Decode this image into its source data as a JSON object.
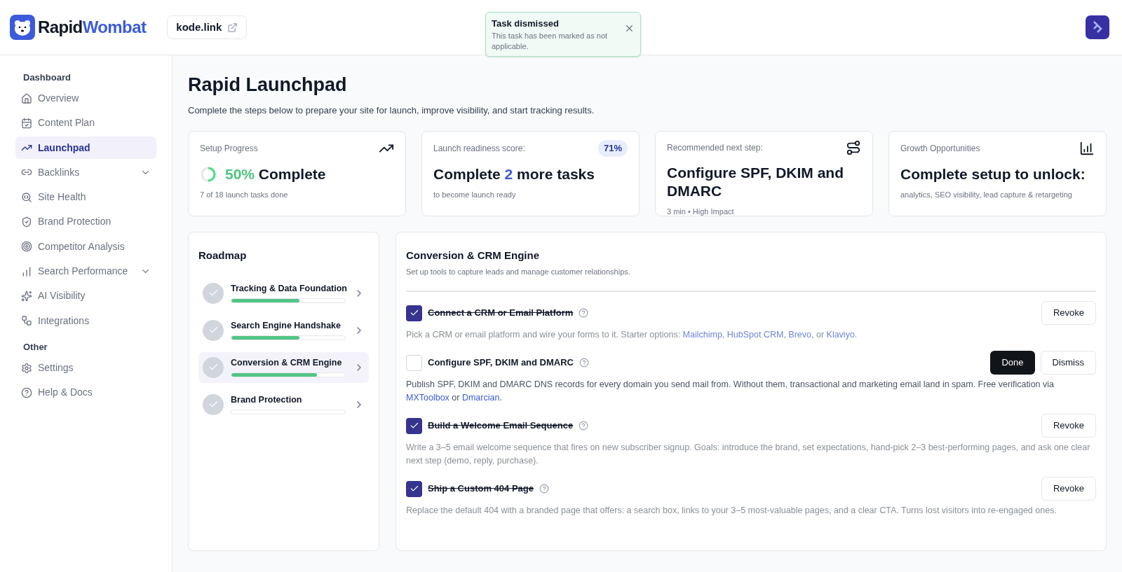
{
  "brand": {
    "first": "Rapid",
    "second": "Wombat"
  },
  "site_link": "kode.link",
  "toast": {
    "title": "Task dismissed",
    "message": "This task has been marked as not applicable."
  },
  "sidebar": {
    "sections": [
      {
        "heading": "Dashboard",
        "items": [
          {
            "label": "Overview",
            "selected": false,
            "has_submenu": false
          },
          {
            "label": "Content Plan",
            "selected": false,
            "has_submenu": false
          },
          {
            "label": "Launchpad",
            "selected": true,
            "has_submenu": false
          },
          {
            "label": "Backlinks",
            "selected": false,
            "has_submenu": true
          },
          {
            "label": "Site Health",
            "selected": false,
            "has_submenu": false
          },
          {
            "label": "Brand Protection",
            "selected": false,
            "has_submenu": false
          },
          {
            "label": "Competitor Analysis",
            "selected": false,
            "has_submenu": false
          },
          {
            "label": "Search Performance",
            "selected": false,
            "has_submenu": true
          },
          {
            "label": "AI Visibility",
            "selected": false,
            "has_submenu": false
          },
          {
            "label": "Integrations",
            "selected": false,
            "has_submenu": false
          }
        ]
      },
      {
        "heading": "Other",
        "items": [
          {
            "label": "Settings",
            "selected": false,
            "has_submenu": false
          },
          {
            "label": "Help & Docs",
            "selected": false,
            "has_submenu": false
          }
        ]
      }
    ]
  },
  "page": {
    "title": "Rapid Launchpad",
    "subtitle": "Complete the steps below to prepare your site for launch, improve visibility, and start tracking results."
  },
  "cards": [
    {
      "kind": "progress",
      "label": "Setup Progress",
      "level": 0.5,
      "headline": [
        {
          "text": "50%",
          "accent": true
        },
        {
          "text": " Complete",
          "accent": false
        }
      ],
      "note": "7 of 18 launch tasks done"
    },
    {
      "kind": "score",
      "label": "Launch readiness score:",
      "badge": "71%",
      "headline": [
        {
          "text": "Complete ",
          "accent": false
        },
        {
          "text": "2",
          "accent": true
        },
        {
          "text": " more tasks",
          "accent": false
        }
      ],
      "note": "to become launch ready"
    },
    {
      "kind": "next",
      "label": "Recommended next step:",
      "headline": [
        {
          "text": "Configure SPF, DKIM and DMARC",
          "accent": false
        }
      ],
      "note": "3 min • High Impact"
    },
    {
      "kind": "growth",
      "label": "Growth Opportunities",
      "headline": [
        {
          "text": "Complete setup to unlock:",
          "accent": false
        }
      ],
      "note": "analytics, SEO visibility, lead capture & retargeting"
    }
  ],
  "roadmap": {
    "title": "Roadmap",
    "items": [
      {
        "label": "Tracking & Data Foundation",
        "level": 0.6,
        "selected": false
      },
      {
        "label": "Search Engine Handshake",
        "level": 0.6,
        "selected": false
      },
      {
        "label": "Conversion & CRM Engine",
        "level": 0.75,
        "selected": true
      },
      {
        "label": "Brand Protection",
        "level": 0,
        "selected": false
      }
    ]
  },
  "section": {
    "title": "Conversion & CRM Engine",
    "subtitle": "Set up tools to capture leads and manage customer relationships.",
    "tasks": [
      {
        "title": "Connect a CRM or Email Platform",
        "checked": true,
        "description": [
          {
            "kind": "text",
            "text": "Pick a CRM or email platform and wire your forms to it. Starter options: "
          },
          {
            "kind": "link",
            "text": "Mailchimp"
          },
          {
            "kind": "text",
            "text": ", "
          },
          {
            "kind": "link",
            "text": "HubSpot CRM"
          },
          {
            "kind": "text",
            "text": ", "
          },
          {
            "kind": "link",
            "text": "Brevo"
          },
          {
            "kind": "text",
            "text": ", or "
          },
          {
            "kind": "link",
            "text": "Klaviyo"
          },
          {
            "kind": "text",
            "text": "."
          }
        ],
        "actions": [
          {
            "kind": "secondary",
            "label": "Revoke"
          }
        ]
      },
      {
        "title": "Configure SPF, DKIM and DMARC",
        "checked": false,
        "description": [
          {
            "kind": "text",
            "text": "Publish SPF, DKIM and DMARC DNS records for every domain you send mail from. Without them, transactional and marketing email land in spam. Free verification via "
          },
          {
            "kind": "link",
            "text": "MXToolbox"
          },
          {
            "kind": "text",
            "text": " or "
          },
          {
            "kind": "link",
            "text": "Dmarcian"
          },
          {
            "kind": "text",
            "text": "."
          }
        ],
        "actions": [
          {
            "kind": "primary",
            "label": "Done"
          },
          {
            "kind": "secondary",
            "label": "Dismiss"
          }
        ]
      },
      {
        "title": "Build a Welcome Email Sequence",
        "checked": true,
        "description": [
          {
            "kind": "text",
            "text": "Write a 3–5 email welcome sequence that fires on new subscriber signup. Goals: introduce the brand, set expectations, hand-pick 2–3 best-performing pages, and ask one clear next step (demo, reply, purchase)."
          }
        ],
        "actions": [
          {
            "kind": "secondary",
            "label": "Revoke"
          }
        ]
      },
      {
        "title": "Ship a Custom 404 Page",
        "checked": true,
        "description": [
          {
            "kind": "text",
            "text": "Replace the default 404 with a branded page that offers: a search box, links to your 3–5 most-valuable pages, and a clear CTA. Turns lost visitors into re-engaged ones."
          }
        ],
        "actions": [
          {
            "kind": "secondary",
            "label": "Revoke"
          }
        ]
      }
    ]
  }
}
